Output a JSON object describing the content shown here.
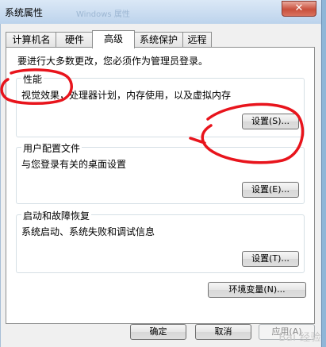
{
  "window": {
    "title": "系统属性",
    "ghost_title": "Windows 属性",
    "close_glyph": "✕"
  },
  "tabs": [
    {
      "label": "计算机名",
      "active": false
    },
    {
      "label": "硬件",
      "active": false
    },
    {
      "label": "高级",
      "active": true
    },
    {
      "label": "系统保护",
      "active": false
    },
    {
      "label": "远程",
      "active": false
    }
  ],
  "advanced": {
    "admin_note": "要进行大多数更改，您必须作为管理员登录。",
    "performance": {
      "title": "性能",
      "description": "视觉效果，处理器计划，内存使用，以及虚拟内存",
      "button_label": "设置(S)..."
    },
    "user_profiles": {
      "title": "用户配置文件",
      "description": "与您登录有关的桌面设置",
      "button_label": "设置(E)..."
    },
    "startup_recovery": {
      "title": "启动和故障恢复",
      "description": "系统启动、系统失败和调试信息",
      "button_label": "设置(T)..."
    },
    "env_button_label": "环境变量(N)..."
  },
  "footer": {
    "ok_label": "确定",
    "cancel_label": "取消",
    "apply_label": "应用(A)"
  },
  "watermark": "Bai 经验",
  "colors": {
    "annotation": "#e8141c"
  }
}
